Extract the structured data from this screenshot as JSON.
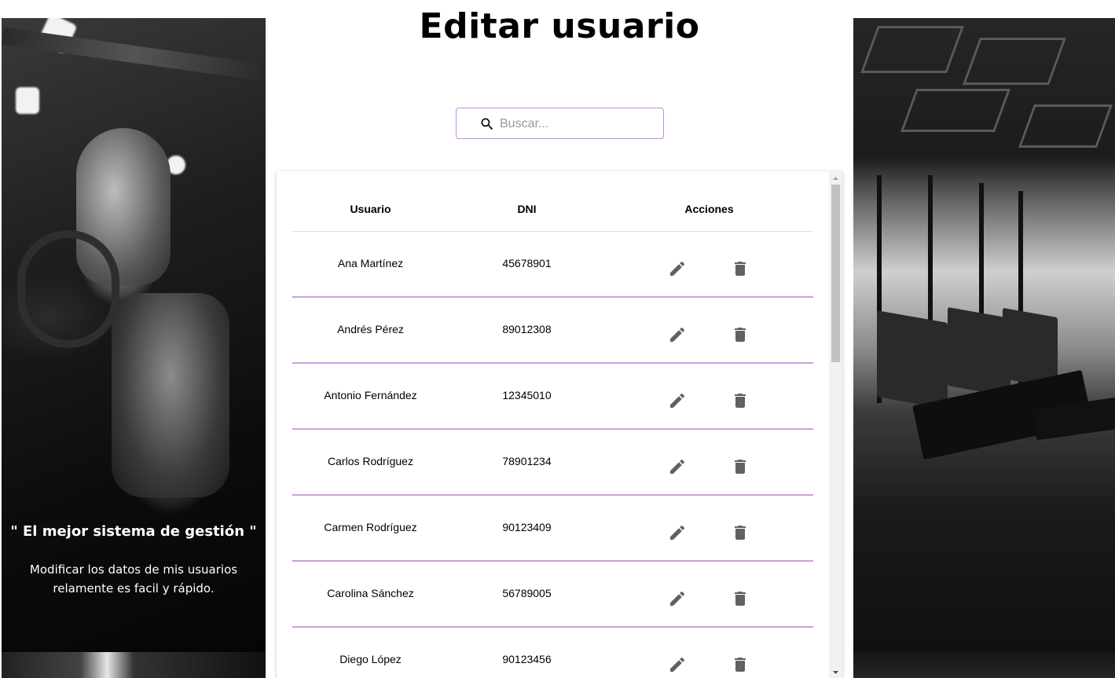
{
  "page": {
    "title": "Editar usuario"
  },
  "search": {
    "placeholder": "Buscar...",
    "value": ""
  },
  "side_left": {
    "quote_title": "\" El mejor sistema de gestión \"",
    "quote_text": "Modificar los datos de mis usuarios relamente es facil y rápido."
  },
  "table": {
    "headers": {
      "user": "Usuario",
      "dni": "DNI",
      "actions": "Acciones"
    },
    "rows": [
      {
        "name": "Ana Martínez",
        "dni": "45678901"
      },
      {
        "name": "Andrés Pérez",
        "dni": "89012308"
      },
      {
        "name": "Antonio Fernández",
        "dni": "12345010"
      },
      {
        "name": "Carlos Rodríguez",
        "dni": "78901234"
      },
      {
        "name": "Carmen Rodríguez",
        "dni": "90123409"
      },
      {
        "name": "Carolina Sánchez",
        "dni": "56789005"
      },
      {
        "name": "Diego López",
        "dni": "90123456"
      }
    ],
    "action_icons": {
      "edit": "edit-icon",
      "delete": "trash-icon"
    }
  },
  "colors": {
    "accent": "#c58be0",
    "row_divider": "#c9a0dc",
    "icon": "#616161"
  }
}
